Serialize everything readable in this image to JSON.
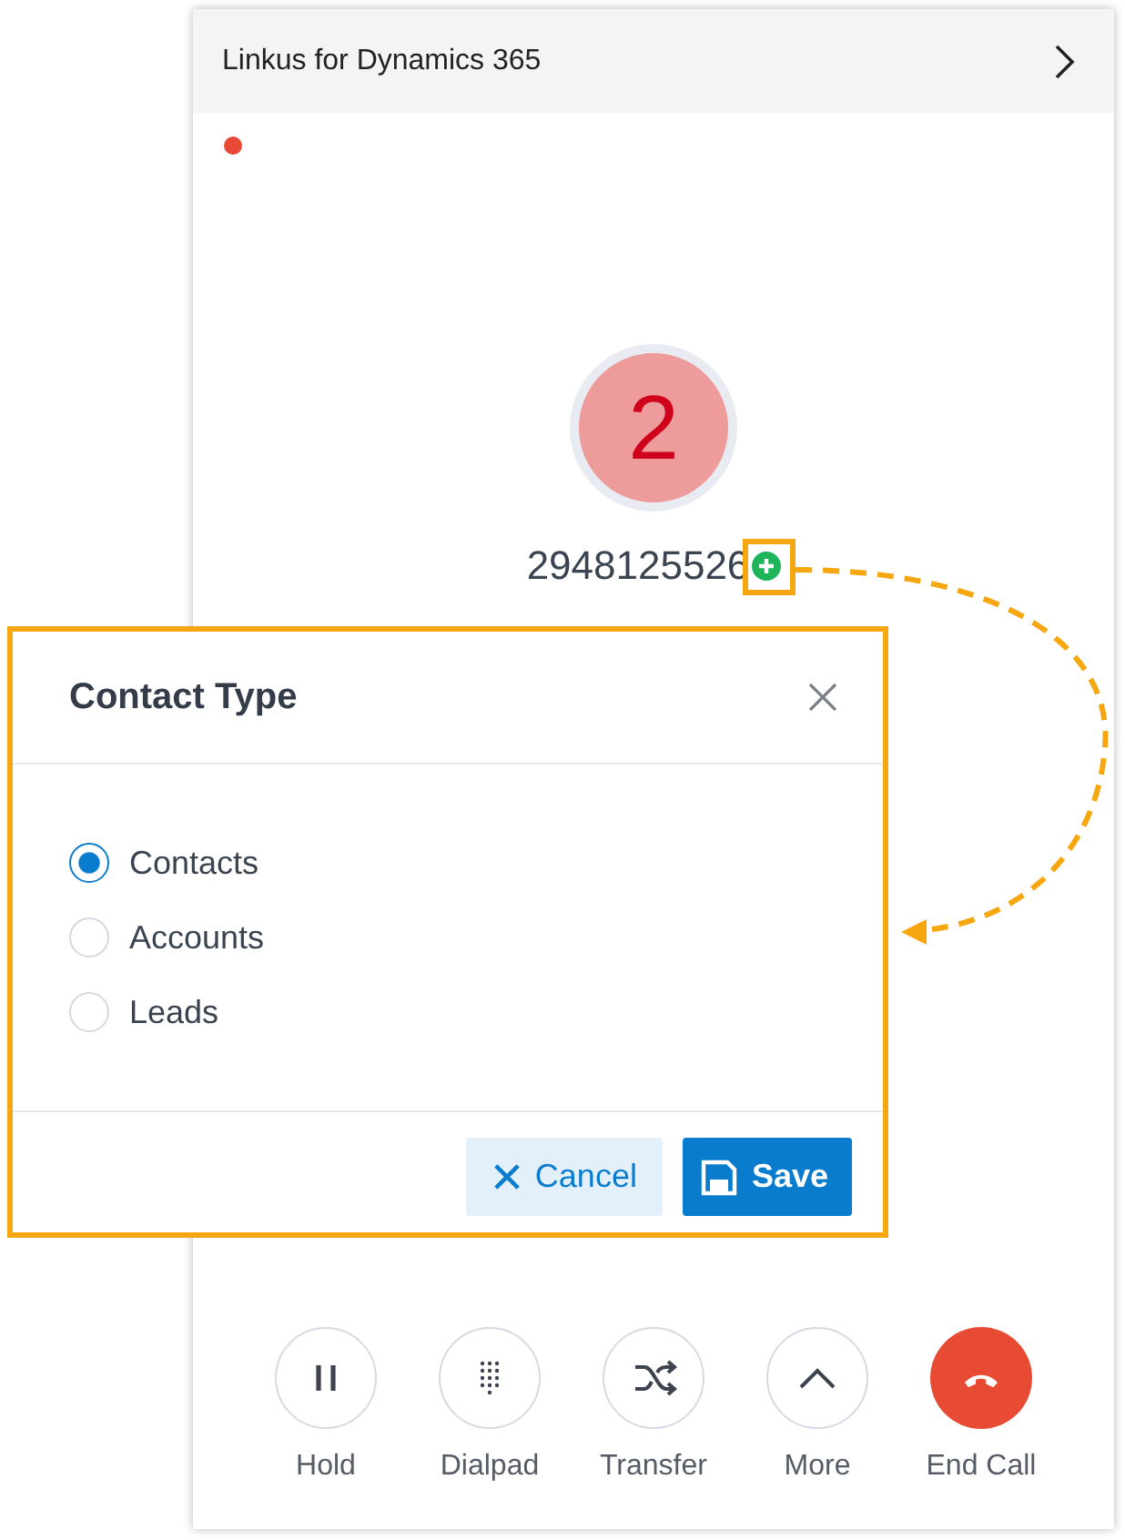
{
  "panel": {
    "title": "Linkus for Dynamics 365"
  },
  "caller": {
    "avatar_text": "2",
    "number": "2948125526"
  },
  "dialog": {
    "title": "Contact Type",
    "options": [
      {
        "label": "Contacts",
        "selected": true
      },
      {
        "label": "Accounts",
        "selected": false
      },
      {
        "label": "Leads",
        "selected": false
      }
    ],
    "buttons": [
      {
        "label": "Cancel",
        "kind": "cancel"
      },
      {
        "label": "Save",
        "kind": "save"
      }
    ]
  },
  "controls": [
    {
      "label": "Hold",
      "kind": "hold"
    },
    {
      "label": "Dialpad",
      "kind": "dialpad"
    },
    {
      "label": "Transfer",
      "kind": "transfer"
    },
    {
      "label": "More",
      "kind": "more"
    },
    {
      "label": "End Call",
      "kind": "end"
    }
  ]
}
